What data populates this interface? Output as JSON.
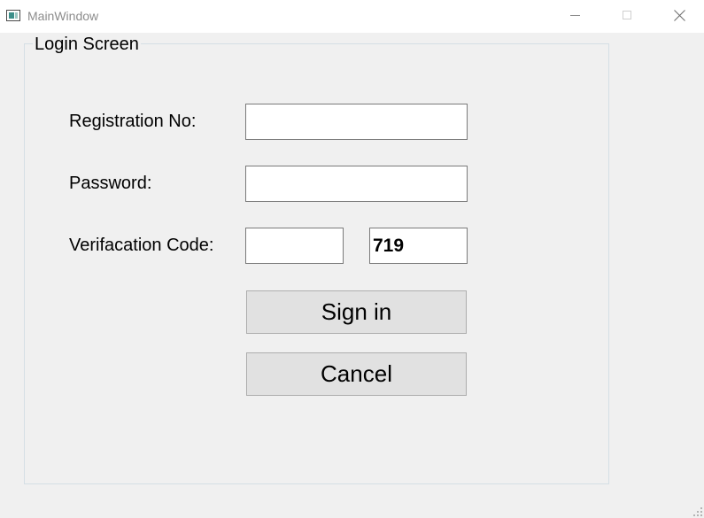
{
  "window": {
    "title": "MainWindow",
    "controls": [
      "minimize-icon",
      "maximize-icon",
      "close-icon"
    ]
  },
  "group": {
    "title": "Login Screen"
  },
  "form": {
    "registration_label": "Registration No:",
    "registration_value": "",
    "password_label": "Password:",
    "password_value": "",
    "verification_label": "Verifacation Code:",
    "verification_input_value": "",
    "verification_code": "719"
  },
  "buttons": {
    "sign_in": "Sign in",
    "cancel": "Cancel"
  }
}
